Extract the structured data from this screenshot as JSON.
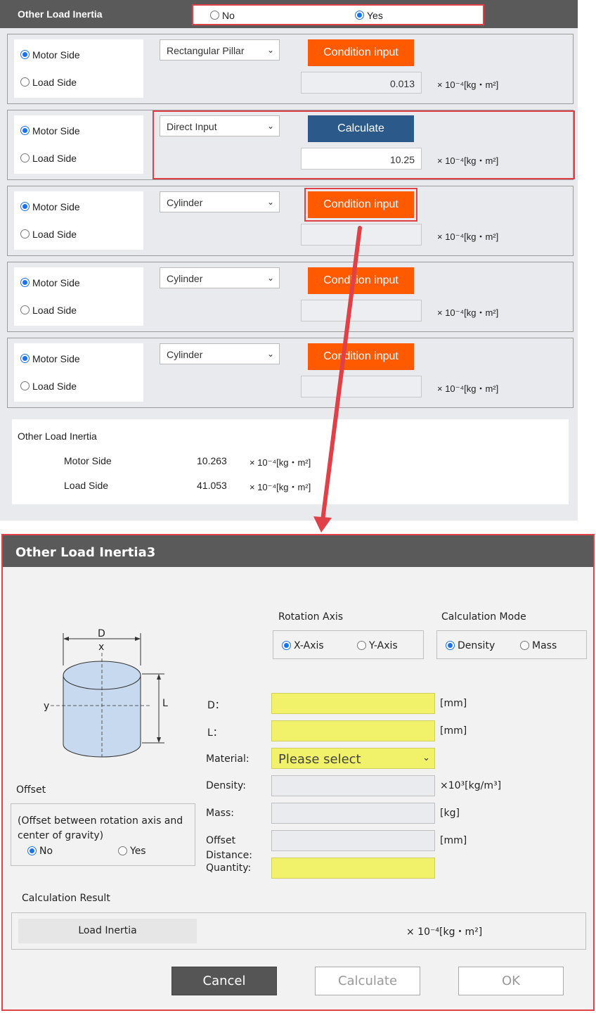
{
  "top": {
    "title": "Other Load Inertia",
    "yn_options": [
      {
        "label": "No",
        "selected": false
      },
      {
        "label": "Yes",
        "selected": true
      }
    ],
    "rows": [
      {
        "motor_label": "Motor Side",
        "load_label": "Load Side",
        "motor_selected": true,
        "shape": "Rectangular Pillar",
        "button": "Condition input",
        "value": "0.013",
        "unit": "× 10⁻⁴[kg・m²]"
      },
      {
        "motor_label": "Motor Side",
        "load_label": "Load Side",
        "motor_selected": true,
        "shape": "Direct Input",
        "button": "Calculate",
        "value": "10.25",
        "unit": "× 10⁻⁴[kg・m²]"
      },
      {
        "motor_label": "Motor Side",
        "load_label": "Load Side",
        "motor_selected": true,
        "shape": "Cylinder",
        "button": "Condition input",
        "value": "",
        "unit": "× 10⁻⁴[kg・m²]"
      },
      {
        "motor_label": "Motor Side",
        "load_label": "Load Side",
        "motor_selected": true,
        "shape": "Cylinder",
        "button": "Condition input",
        "value": "",
        "unit": "× 10⁻⁴[kg・m²]"
      },
      {
        "motor_label": "Motor Side",
        "load_label": "Load Side",
        "motor_selected": true,
        "shape": "Cylinder",
        "button": "Condition input",
        "value": "",
        "unit": "× 10⁻⁴[kg・m²]"
      }
    ],
    "summary": {
      "title": "Other Load Inertia",
      "motor_label": "Motor Side",
      "motor_value": "10.263",
      "load_label": "Load Side",
      "load_value": "41.053",
      "unit": "× 10⁻⁴[kg・m²]"
    }
  },
  "dialog": {
    "title": "Other Load Inertia3",
    "diagram": {
      "d": "D",
      "x": "x",
      "y": "y",
      "l": "L"
    },
    "rotation_axis": {
      "label": "Rotation Axis",
      "x": "X-Axis",
      "y": "Y-Axis",
      "selected": "X-Axis"
    },
    "calc_mode": {
      "label": "Calculation Mode",
      "density": "Density",
      "mass": "Mass",
      "selected": "Density"
    },
    "fields": {
      "d_label": "D：",
      "d_unit": "[mm]",
      "l_label": "L：",
      "l_unit": "[mm]",
      "material_label": "Material:",
      "material_value": "Please select",
      "density_label": "Density:",
      "density_unit": "×10³[kg/m³]",
      "mass_label": "Mass:",
      "mass_unit": "[kg]",
      "offset_label": "Offset",
      "offset_label2": "Distance:",
      "offset_unit": "[mm]",
      "quantity_label": "Quantity:"
    },
    "offset": {
      "title": "Offset",
      "desc": "(Offset between rotation axis and center of gravity)",
      "no": "No",
      "yes": "Yes",
      "selected": "No"
    },
    "result": {
      "title": "Calculation Result",
      "label": "Load Inertia",
      "unit": "× 10⁻⁴[kg・m²]"
    },
    "buttons": {
      "cancel": "Cancel",
      "calculate": "Calculate",
      "ok": "OK"
    }
  },
  "colors": {
    "orange": "#ff5a00",
    "blue": "#2b5a8a",
    "highlight": "#e04048",
    "yellow": "#f1f16a",
    "header": "#5a5a5a"
  }
}
